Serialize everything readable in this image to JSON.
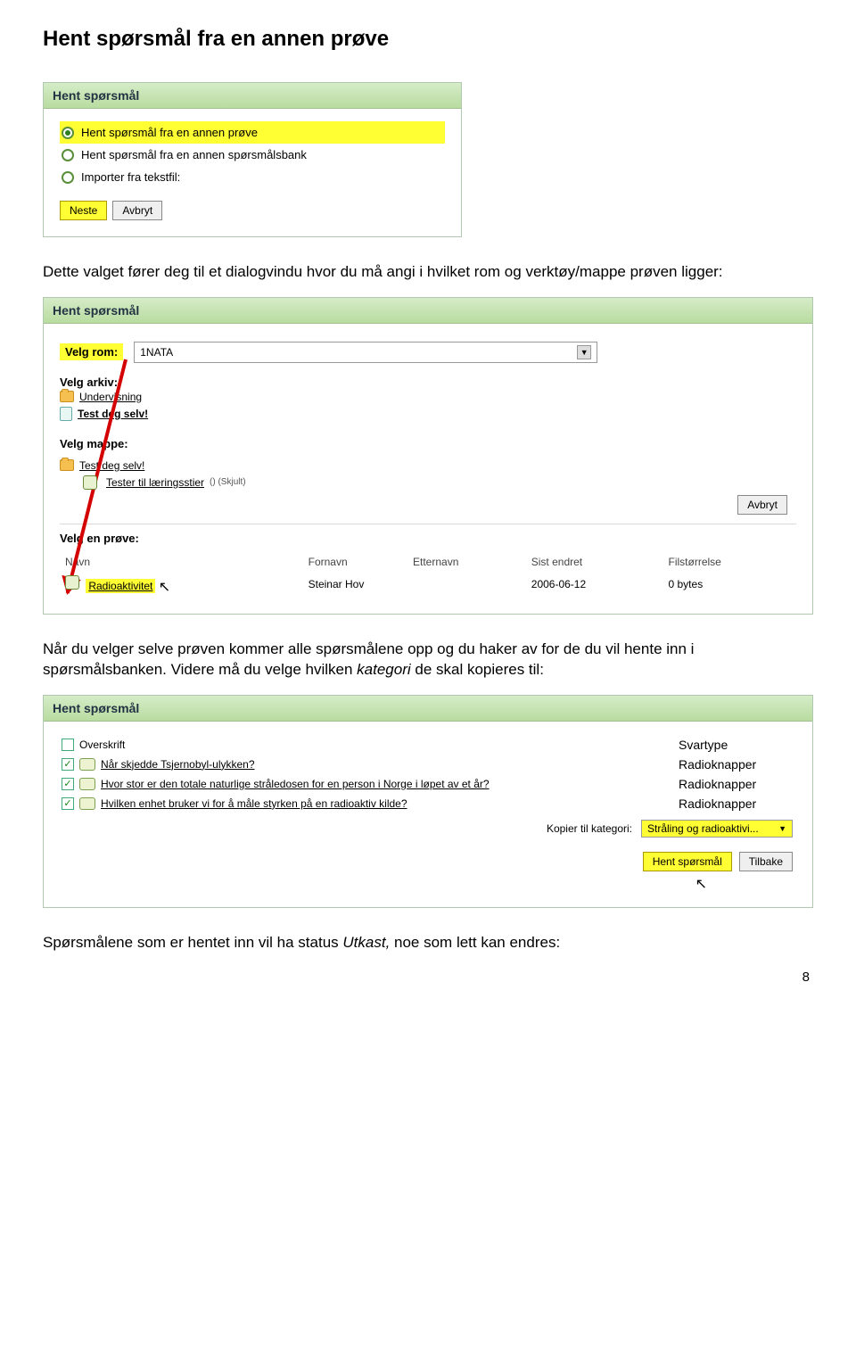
{
  "page": {
    "title": "Hent spørsmål fra en annen prøve",
    "para1": "Dette valget fører deg til et dialogvindu hvor du må angi i hvilket rom og verktøy/mappe prøven ligger:",
    "para2_a": "Når du velger selve prøven kommer alle spørsmålene opp og du haker av for de du vil hente inn i spørsmålsbanken. Videre må du velge hvilken ",
    "para2_i": "kategori",
    "para2_b": " de skal kopieres til:",
    "para3_a": "Spørsmålene som er hentet inn vil ha status ",
    "para3_i": "Utkast,",
    "para3_b": " noe som lett kan endres:",
    "pagenum": "8"
  },
  "panel1": {
    "header": "Hent spørsmål",
    "opt1": "Hent spørsmål fra en annen prøve",
    "opt2": "Hent spørsmål fra en annen spørsmålsbank",
    "opt3": "Importer fra tekstfil:",
    "next": "Neste",
    "cancel": "Avbryt"
  },
  "panel2": {
    "header": "Hent spørsmål",
    "room_label": "Velg rom:",
    "room_value": "1NATA",
    "archive_label": "Velg arkiv:",
    "archive_item1": "Undervisning",
    "archive_item2": "Test deg selv!",
    "folder_label": "Velg mappe:",
    "folder_item1": "Test deg selv!",
    "folder_item2": "Tester til læringsstier",
    "folder_item2_suffix": "() (Skjult)",
    "cancel": "Avbryt",
    "test_label": "Velg en prøve:",
    "th_name": "Navn",
    "th_fornavn": "Fornavn",
    "th_etternavn": "Etternavn",
    "th_sist": "Sist endret",
    "th_size": "Filstørrelse",
    "row_name": "Radioaktivitet",
    "row_user": "Steinar Hov",
    "row_date": "2006-06-12",
    "row_size": "0 bytes"
  },
  "panel3": {
    "header": "Hent spørsmål",
    "th_over": "Overskrift",
    "th_svar": "Svartype",
    "q1": "Når skjedde Tsjernobyl-ulykken?",
    "q2": "Hvor stor er den totale naturlige stråledosen for en person i Norge i løpet av et år?",
    "q3": "Hvilken enhet bruker vi for å måle styrken på en radioaktiv kilde?",
    "ans": "Radioknapper",
    "copy_label": "Kopier til kategori:",
    "copy_value": "Stråling og radioaktivi...",
    "btn_get": "Hent spørsmål",
    "btn_back": "Tilbake"
  }
}
